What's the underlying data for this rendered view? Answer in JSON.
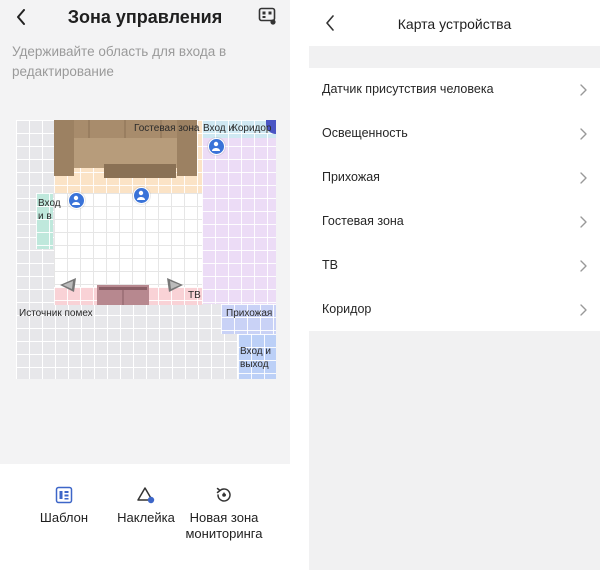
{
  "left_screen": {
    "title": "Зона управления",
    "hint": "Удерживайте область для входа в редактирование",
    "back_icon": "chevron-left-icon",
    "qr_icon": "qr-scan-icon",
    "map": {
      "labels": {
        "guest_zone": "Гостевая зона",
        "entrance": "Вход и",
        "corridor": "Коридор",
        "entrance_vertical": "Вход и в",
        "tv": "ТВ",
        "noise_source": "Источник помех",
        "hallway": "Прихожая",
        "entrance_bottom": "Вход и выход"
      },
      "zone_colors": {
        "living": "#fbe3c6",
        "purple": "#ecdcf6",
        "pink": "#f9d2d6",
        "blue": "#c9d2f6",
        "teal": "#bfe8dc",
        "sensor_pin": "#3a73d8"
      }
    },
    "toolbar": [
      {
        "label": "Шаблон",
        "icon": "template-icon"
      },
      {
        "label": "Наклейка",
        "icon": "sticker-icon"
      },
      {
        "label": "Новая зона мониторинга",
        "icon": "monitoring-zone-icon"
      }
    ]
  },
  "right_screen": {
    "title": "Карта устройства",
    "back_icon": "chevron-left-icon",
    "items": [
      {
        "label": "Датчик присутствия человека"
      },
      {
        "label": "Освещенность"
      },
      {
        "label": "Прихожая"
      },
      {
        "label": "Гостевая зона"
      },
      {
        "label": "ТВ"
      },
      {
        "label": "Коридор"
      }
    ]
  }
}
